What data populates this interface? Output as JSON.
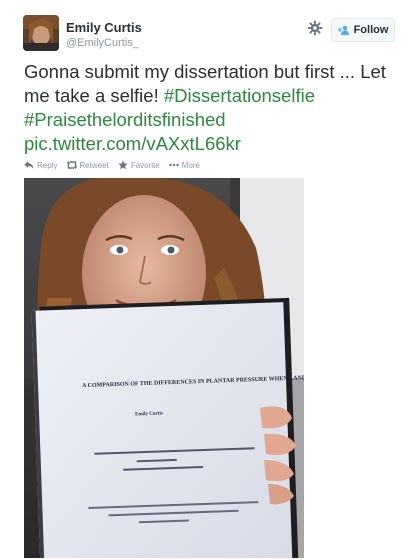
{
  "user": {
    "name": "Emily Curtis",
    "handle": "@EmilyCurtis_"
  },
  "follow_button": {
    "label": "Follow"
  },
  "tweet": {
    "text_part1": "Gonna submit my dissertation but first ... Let me take a selfie! ",
    "hashtag1": "#Dissertationselfie",
    "hashtag2": "#Praisethelorditsfinished",
    "link": "pic.twitter.com/vAXxtL66kr"
  },
  "actions": [
    {
      "label": "Reply",
      "icon": "reply-icon"
    },
    {
      "label": "Retweet",
      "icon": "retweet-icon"
    },
    {
      "label": "Favorite",
      "icon": "star-icon"
    },
    {
      "label": "More",
      "icon": "ellipsis-icon"
    }
  ],
  "photo": {
    "document_title": "A COMPARISON OF THE DIFFERENCES IN PLANTAR PRESSURE WHEN LANDING A JUMP IN A RANGE OF DANCE FOOTWEAR",
    "document_author": "Emily Curtis"
  },
  "colors": {
    "link": "#2b8a3e",
    "text": "#292f33",
    "muted": "#8899a6"
  }
}
